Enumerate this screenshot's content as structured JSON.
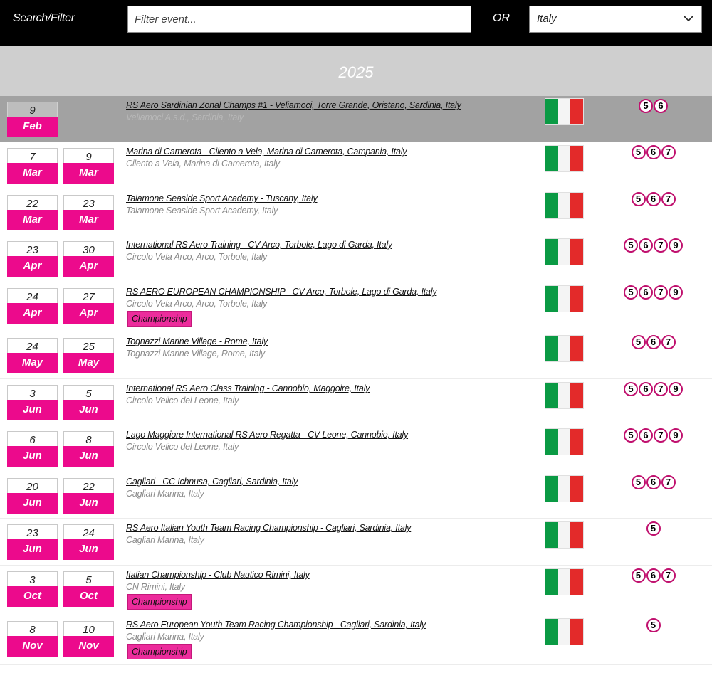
{
  "header": {
    "search_label": "Search/Filter",
    "filter_placeholder": "Filter event...",
    "or_label": "OR",
    "country_selected": "Italy"
  },
  "year": "2025",
  "colors": {
    "accent": "#ec0a8c",
    "highlight_row": "#a2a2a2",
    "flag_green": "#0a9a44",
    "flag_red": "#e32a2a"
  },
  "events": [
    {
      "start_day": "9",
      "start_mon": "Feb",
      "end_day": "",
      "end_mon": "",
      "title": "RS Aero Sardinian Zonal Champs #1 - Veliamoci, Torre Grande, Oristano, Sardinia, Italy",
      "venue": "Veliamoci A.s.d., Sardinia, Italy",
      "badge": "",
      "classes": [
        "5",
        "6"
      ],
      "highlighted": true,
      "flag": "italy-flag"
    },
    {
      "start_day": "7",
      "start_mon": "Mar",
      "end_day": "9",
      "end_mon": "Mar",
      "title": "Marina di Camerota - Cilento a Vela, Marina di Camerota, Campania, Italy",
      "venue": "Cilento a Vela, Marina di Camerota, Italy",
      "badge": "",
      "classes": [
        "5",
        "6",
        "7"
      ],
      "highlighted": false,
      "flag": "italy-flag"
    },
    {
      "start_day": "22",
      "start_mon": "Mar",
      "end_day": "23",
      "end_mon": "Mar",
      "title": "Talamone Seaside Sport Academy - Tuscany, Italy",
      "venue": "Talamone Seaside Sport Academy, Italy",
      "badge": "",
      "classes": [
        "5",
        "6",
        "7"
      ],
      "highlighted": false,
      "flag": "italy-flag"
    },
    {
      "start_day": "23",
      "start_mon": "Apr",
      "end_day": "30",
      "end_mon": "Apr",
      "title": "International RS Aero Training - CV Arco, Torbole, Lago di Garda, Italy",
      "venue": "Circolo Vela Arco, Arco, Torbole, Italy",
      "badge": "",
      "classes": [
        "5",
        "6",
        "7",
        "9"
      ],
      "highlighted": false,
      "flag": "italy-flag"
    },
    {
      "start_day": "24",
      "start_mon": "Apr",
      "end_day": "27",
      "end_mon": "Apr",
      "title": "RS AERO EUROPEAN CHAMPIONSHIP - CV Arco, Torbole, Lago di Garda, Italy",
      "venue": "Circolo Vela Arco, Arco, Torbole, Italy",
      "badge": "Championship",
      "classes": [
        "5",
        "6",
        "7",
        "9"
      ],
      "highlighted": false,
      "flag": "italy-flag"
    },
    {
      "start_day": "24",
      "start_mon": "May",
      "end_day": "25",
      "end_mon": "May",
      "title": "Tognazzi Marine Village - Rome, Italy",
      "venue": "Tognazzi Marine Village, Rome, Italy",
      "badge": "",
      "classes": [
        "5",
        "6",
        "7"
      ],
      "highlighted": false,
      "flag": "italy-flag"
    },
    {
      "start_day": "3",
      "start_mon": "Jun",
      "end_day": "5",
      "end_mon": "Jun",
      "title": "International RS Aero Class Training - Cannobio, Maggoire, Italy",
      "venue": "Circolo Velico del Leone, Italy",
      "badge": "",
      "classes": [
        "5",
        "6",
        "7",
        "9"
      ],
      "highlighted": false,
      "flag": "italy-flag"
    },
    {
      "start_day": "6",
      "start_mon": "Jun",
      "end_day": "8",
      "end_mon": "Jun",
      "title": "Lago Maggiore International RS Aero Regatta - CV Leone, Cannobio, Italy",
      "venue": "Circolo Velico del Leone, Italy",
      "badge": "",
      "classes": [
        "5",
        "6",
        "7",
        "9"
      ],
      "highlighted": false,
      "flag": "italy-flag"
    },
    {
      "start_day": "20",
      "start_mon": "Jun",
      "end_day": "22",
      "end_mon": "Jun",
      "title": "Cagliari - CC Ichnusa, Cagliari, Sardinia, Italy",
      "venue": "Cagliari Marina, Italy",
      "badge": "",
      "classes": [
        "5",
        "6",
        "7"
      ],
      "highlighted": false,
      "flag": "italy-flag"
    },
    {
      "start_day": "23",
      "start_mon": "Jun",
      "end_day": "24",
      "end_mon": "Jun",
      "title": "RS Aero Italian Youth Team Racing Championship - Cagliari, Sardinia, Italy",
      "venue": "Cagliari Marina, Italy",
      "badge": "",
      "classes": [
        "5"
      ],
      "highlighted": false,
      "flag": "italy-flag"
    },
    {
      "start_day": "3",
      "start_mon": "Oct",
      "end_day": "5",
      "end_mon": "Oct",
      "title": "Italian Championship - Club Nautico Rimini, Italy",
      "venue": "CN Rimini, Italy",
      "badge": "Championship",
      "classes": [
        "5",
        "6",
        "7"
      ],
      "highlighted": false,
      "flag": "italy-flag"
    },
    {
      "start_day": "8",
      "start_mon": "Nov",
      "end_day": "10",
      "end_mon": "Nov",
      "title": "RS Aero European Youth Team Racing Championship - Cagliari, Sardinia, Italy",
      "venue": "Cagliari Marina, Italy",
      "badge": "Championship",
      "classes": [
        "5"
      ],
      "highlighted": false,
      "flag": "italy-flag"
    }
  ]
}
